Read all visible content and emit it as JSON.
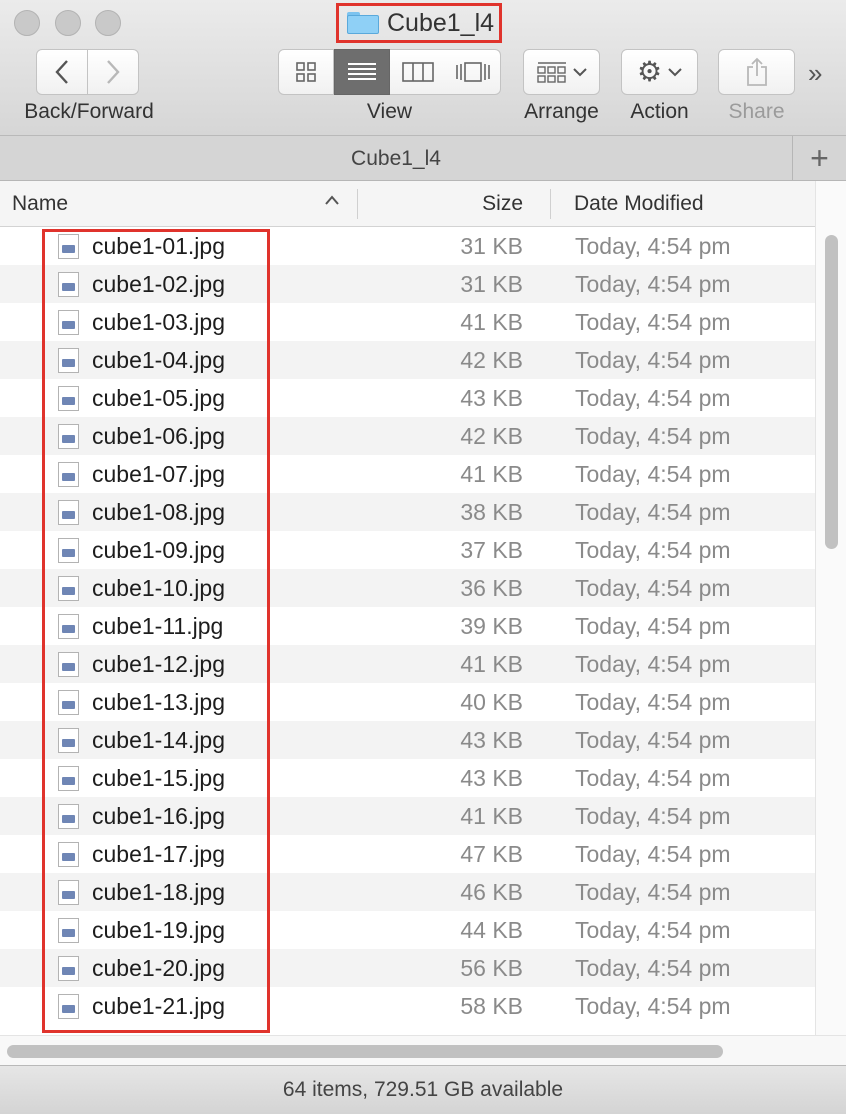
{
  "window": {
    "title": "Cube1_l4"
  },
  "toolbar": {
    "back_forward_label": "Back/Forward",
    "view_label": "View",
    "arrange_label": "Arrange",
    "action_label": "Action",
    "share_label": "Share",
    "overflow": "»",
    "active_view": "list"
  },
  "pathbar": {
    "title": "Cube1_l4",
    "add_tab": "+"
  },
  "columns": {
    "name": "Name",
    "size": "Size",
    "date": "Date Modified",
    "sort_indicator": "^"
  },
  "files": [
    {
      "name": "cube1-01.jpg",
      "size": "31 KB",
      "date": "Today, 4:54 pm"
    },
    {
      "name": "cube1-02.jpg",
      "size": "31 KB",
      "date": "Today, 4:54 pm"
    },
    {
      "name": "cube1-03.jpg",
      "size": "41 KB",
      "date": "Today, 4:54 pm"
    },
    {
      "name": "cube1-04.jpg",
      "size": "42 KB",
      "date": "Today, 4:54 pm"
    },
    {
      "name": "cube1-05.jpg",
      "size": "43 KB",
      "date": "Today, 4:54 pm"
    },
    {
      "name": "cube1-06.jpg",
      "size": "42 KB",
      "date": "Today, 4:54 pm"
    },
    {
      "name": "cube1-07.jpg",
      "size": "41 KB",
      "date": "Today, 4:54 pm"
    },
    {
      "name": "cube1-08.jpg",
      "size": "38 KB",
      "date": "Today, 4:54 pm"
    },
    {
      "name": "cube1-09.jpg",
      "size": "37 KB",
      "date": "Today, 4:54 pm"
    },
    {
      "name": "cube1-10.jpg",
      "size": "36 KB",
      "date": "Today, 4:54 pm"
    },
    {
      "name": "cube1-11.jpg",
      "size": "39 KB",
      "date": "Today, 4:54 pm"
    },
    {
      "name": "cube1-12.jpg",
      "size": "41 KB",
      "date": "Today, 4:54 pm"
    },
    {
      "name": "cube1-13.jpg",
      "size": "40 KB",
      "date": "Today, 4:54 pm"
    },
    {
      "name": "cube1-14.jpg",
      "size": "43 KB",
      "date": "Today, 4:54 pm"
    },
    {
      "name": "cube1-15.jpg",
      "size": "43 KB",
      "date": "Today, 4:54 pm"
    },
    {
      "name": "cube1-16.jpg",
      "size": "41 KB",
      "date": "Today, 4:54 pm"
    },
    {
      "name": "cube1-17.jpg",
      "size": "47 KB",
      "date": "Today, 4:54 pm"
    },
    {
      "name": "cube1-18.jpg",
      "size": "46 KB",
      "date": "Today, 4:54 pm"
    },
    {
      "name": "cube1-19.jpg",
      "size": "44 KB",
      "date": "Today, 4:54 pm"
    },
    {
      "name": "cube1-20.jpg",
      "size": "56 KB",
      "date": "Today, 4:54 pm"
    },
    {
      "name": "cube1-21.jpg",
      "size": "58 KB",
      "date": "Today, 4:54 pm"
    }
  ],
  "status": {
    "text": "64 items, 729.51 GB available"
  },
  "colors": {
    "highlight": "#e0332c",
    "folder": "#8fd0f6"
  }
}
